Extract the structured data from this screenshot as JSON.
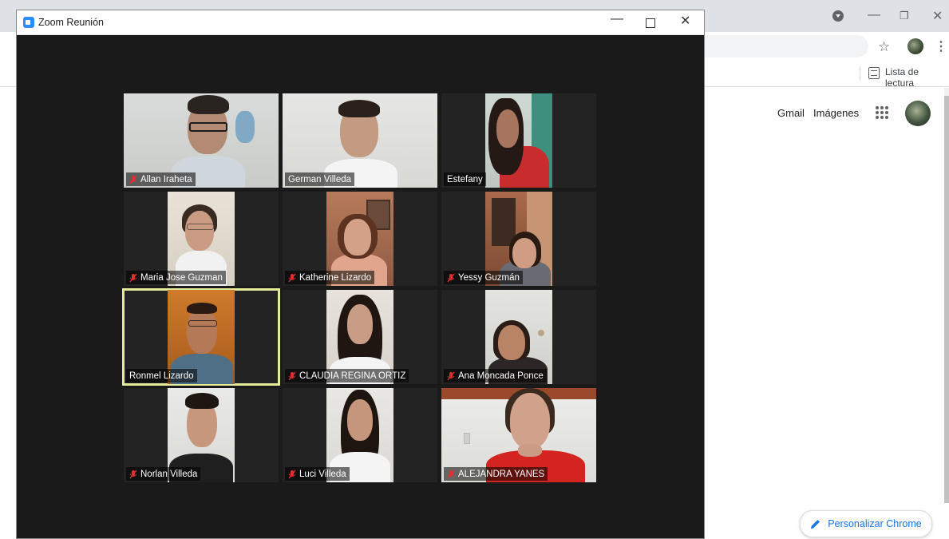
{
  "chrome": {
    "reading_list_label": "Lista de lectura",
    "links": {
      "gmail": "Gmail",
      "images": "Imágenes"
    },
    "customize_label": "Personalizar Chrome",
    "accent": "#1a73e8"
  },
  "zoom": {
    "title": "Zoom Reunión",
    "controls": {
      "minimize": "—",
      "close": "✕"
    },
    "participants": [
      {
        "name": "Allan Iraheta",
        "muted": true,
        "active": false
      },
      {
        "name": "German Villeda",
        "muted": false,
        "active": false
      },
      {
        "name": "Estefany",
        "muted": false,
        "active": false
      },
      {
        "name": "Maria Jose Guzman",
        "muted": true,
        "active": false
      },
      {
        "name": "Katherine Lizardo",
        "muted": true,
        "active": false
      },
      {
        "name": "Yessy Guzmán",
        "muted": true,
        "active": false
      },
      {
        "name": "Ronmel Lizardo",
        "muted": false,
        "active": true
      },
      {
        "name": "CLAUDIA REGINA ORTIZ",
        "muted": true,
        "active": false
      },
      {
        "name": "Ana Moncada Ponce",
        "muted": true,
        "active": false
      },
      {
        "name": "Norlan Villeda",
        "muted": true,
        "active": false
      },
      {
        "name": "Luci Villeda",
        "muted": true,
        "active": false
      },
      {
        "name": "ALEJANDRA YANES",
        "muted": true,
        "active": false
      }
    ],
    "active_speaker_color": "#e6eb9c",
    "muted_icon_color": "#e02f2f"
  }
}
